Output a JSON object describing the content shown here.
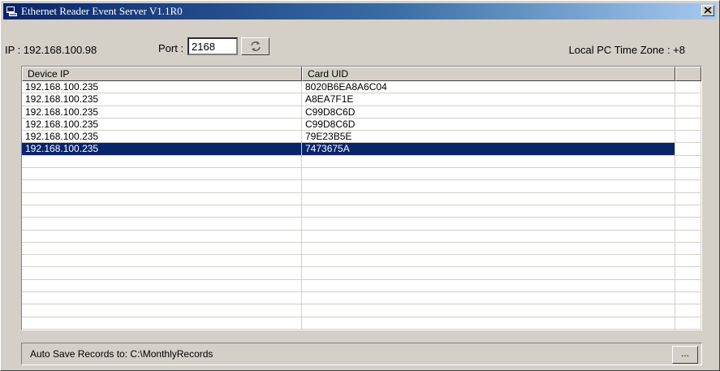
{
  "window": {
    "title": "Ethernet Reader Event Server   V1.1R0"
  },
  "toolbar": {
    "ip_text": "IP : 192.168.100.98",
    "port_label": "Port :",
    "port_value": "2168",
    "timezone_text": "Local PC Time Zone : +8"
  },
  "table": {
    "columns": [
      "Device IP",
      "Card UID"
    ],
    "rows": [
      {
        "device_ip": "192.168.100.235",
        "card_uid": "8020B6EA8A6C04"
      },
      {
        "device_ip": "192.168.100.235",
        "card_uid": "A8EA7F1E"
      },
      {
        "device_ip": "192.168.100.235",
        "card_uid": "C99D8C6D"
      },
      {
        "device_ip": "192.168.100.235",
        "card_uid": "C99D8C6D"
      },
      {
        "device_ip": "192.168.100.235",
        "card_uid": "79E23B5E"
      },
      {
        "device_ip": "192.168.100.235",
        "card_uid": "7473675A"
      }
    ],
    "selected_row": 5,
    "total_visible_rows": 20
  },
  "status": {
    "autosave_text": "Auto Save Records to:  C:\\MonthlyRecords",
    "browse_label": "..."
  },
  "colors": {
    "titlebar_start": "#0a246a",
    "titlebar_end": "#a6caf0",
    "selection": "#0a246a",
    "face": "#d4d0c8"
  }
}
